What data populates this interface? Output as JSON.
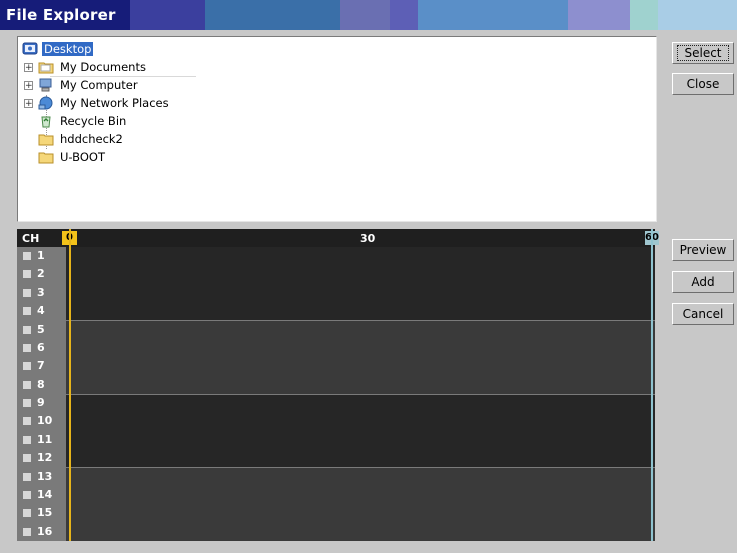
{
  "window": {
    "title": "File Explorer"
  },
  "tree": {
    "items": [
      {
        "label": "Desktop",
        "icon": "desktop-icon",
        "expander": "",
        "selected": true
      },
      {
        "label": "My Documents",
        "icon": "folder-icon",
        "expander": "+"
      },
      {
        "label": "My Computer",
        "icon": "computer-icon",
        "expander": "+"
      },
      {
        "label": "My Network Places",
        "icon": "network-icon",
        "expander": "+"
      },
      {
        "label": "Recycle Bin",
        "icon": "recycle-bin-icon",
        "expander": ""
      },
      {
        "label": "hddcheck2",
        "icon": "folder-icon",
        "expander": ""
      },
      {
        "label": "U-BOOT",
        "icon": "folder-icon",
        "expander": ""
      }
    ]
  },
  "buttons": {
    "select": "Select",
    "close": "Close",
    "preview": "Preview",
    "add": "Add",
    "cancel": "Cancel"
  },
  "timeline": {
    "ch_header": "CH",
    "marks": {
      "start": "0",
      "mid": "30",
      "end": "60"
    },
    "channels": [
      "1",
      "2",
      "3",
      "4",
      "5",
      "6",
      "7",
      "8",
      "9",
      "10",
      "11",
      "12",
      "13",
      "14",
      "15",
      "16"
    ]
  },
  "colors": {
    "title_bar": "#161c79",
    "selection": "#316ac5",
    "cursor_start": "#e6b41a",
    "cursor_end": "#8fc3cf"
  }
}
